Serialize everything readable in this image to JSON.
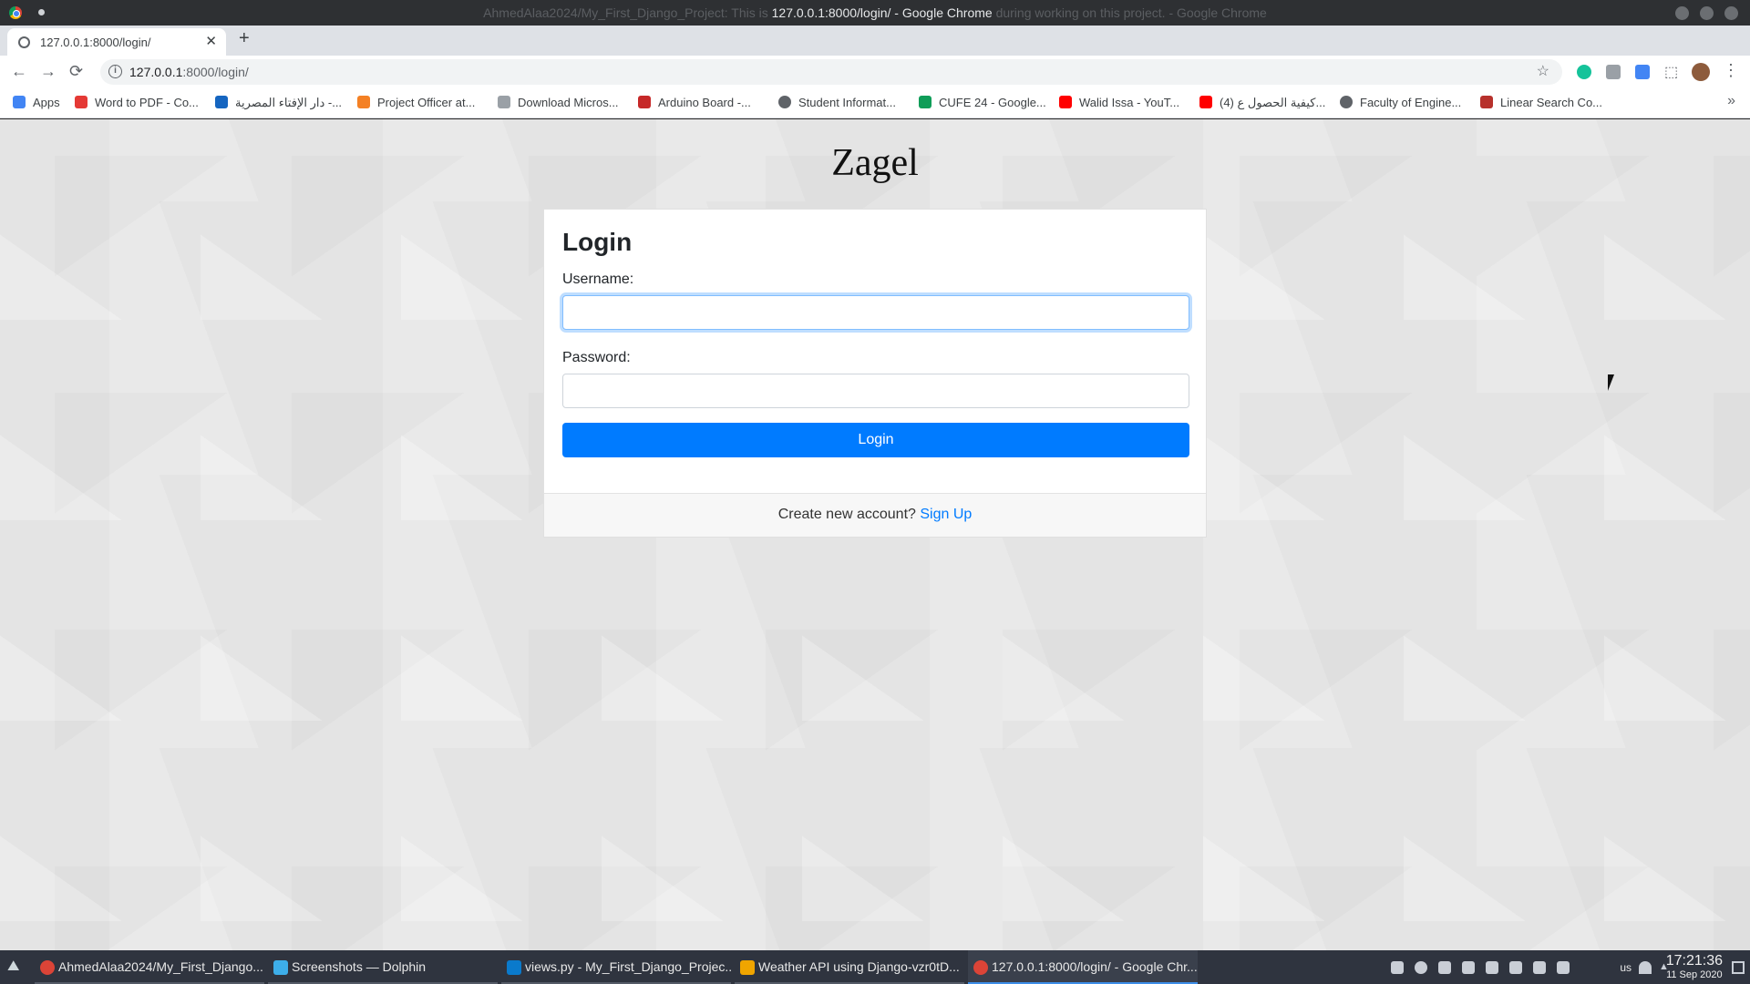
{
  "window": {
    "title_prefix": "AhmedAlaa2024/My_First_Django_Project: This is",
    "title_main": "127.0.0.1:8000/login/ - Google Chrome",
    "title_suffix": "during working on this project. - Google Chrome"
  },
  "tab": {
    "title": "127.0.0.1:8000/login/",
    "close": "✕",
    "new_tab": "+"
  },
  "toolbar": {
    "back": "←",
    "forward": "→",
    "reload": "⟳",
    "info_icon": "i",
    "url_host": "127.0.0.1",
    "url_path": ":8000/login/",
    "star": "☆",
    "puzzle": "⬚",
    "menu": "⋮"
  },
  "bookmarks": {
    "items": [
      {
        "label": "Apps",
        "icon": "apps-grid-icon",
        "color": "#4285f4"
      },
      {
        "label": "Word to PDF - Co...",
        "icon": "word-to-pdf-icon",
        "color": "#e53935"
      },
      {
        "label": "دار الإفتاء المصرية -...",
        "icon": "dar-al-ifta-icon",
        "color": "#1565c0"
      },
      {
        "label": "Project Officer at...",
        "icon": "stackoverflow-icon",
        "color": "#f48024"
      },
      {
        "label": "Download Micros...",
        "icon": "microsoft-download-icon",
        "color": "#5f6368"
      },
      {
        "label": "Arduino Board -...",
        "icon": "arduino-icon",
        "color": "#c62828"
      },
      {
        "label": "Student Informat...",
        "icon": "globe-icon",
        "color": "#5f6368"
      },
      {
        "label": "CUFE 24 - Google...",
        "icon": "google-drive-icon",
        "color": "#0f9d58"
      },
      {
        "label": "Walid Issa - YouT...",
        "icon": "youtube-icon",
        "color": "#ff0000"
      },
      {
        "label": "(4) كيفية الحصول ع...",
        "icon": "youtube-icon",
        "color": "#ff0000"
      },
      {
        "label": "Faculty of Engine...",
        "icon": "globe-icon",
        "color": "#5f6368"
      },
      {
        "label": "Linear Search Co...",
        "icon": "edx-icon",
        "color": "#b7312c"
      }
    ],
    "more": "»"
  },
  "page": {
    "site_title": "Zagel",
    "heading": "Login",
    "username_label": "Username:",
    "username_value": "",
    "password_label": "Password:",
    "password_value": "",
    "login_button": "Login",
    "footer_text": "Create new account?",
    "signup_link": "Sign Up"
  },
  "taskbar": {
    "launcher": "⛰",
    "items": [
      {
        "label": "AhmedAlaa2024/My_First_Django...",
        "icon": "chrome-icon",
        "color": "#db4437",
        "active": false
      },
      {
        "label": "Screenshots — Dolphin",
        "icon": "dolphin-icon",
        "color": "#3daee9",
        "active": false
      },
      {
        "label": "views.py - My_First_Django_Projec...",
        "icon": "vscode-icon",
        "color": "#0a7acc",
        "active": false
      },
      {
        "label": "Weather API using Django-vzr0tD...",
        "icon": "video-player-icon",
        "color": "#f0a500",
        "active": false
      },
      {
        "label": "127.0.0.1:8000/login/ - Google Chr...",
        "icon": "chrome-icon",
        "color": "#db4437",
        "active": true
      }
    ],
    "keyboard_layout": "us",
    "time": "17:21:36",
    "date": "11 Sep 2020"
  },
  "colors": {
    "primary": "#007bff",
    "link": "#007bff",
    "taskbar": "#2f343f",
    "titlebar": "#2e3033"
  }
}
